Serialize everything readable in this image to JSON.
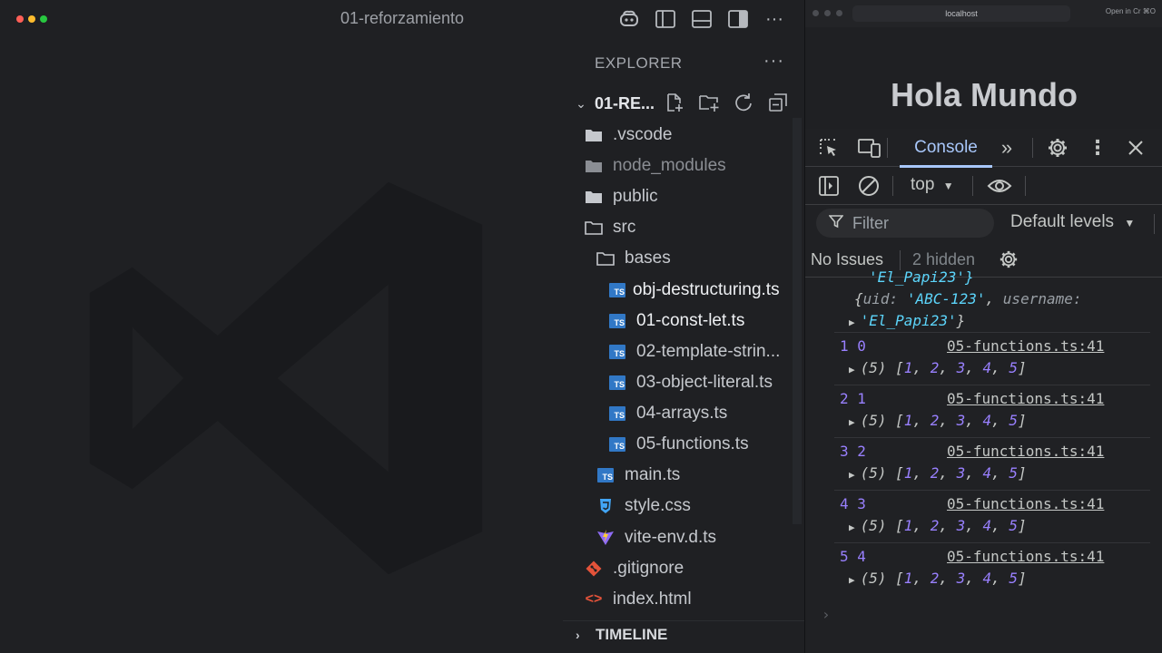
{
  "vscode": {
    "window_title": "01-reforzamiento",
    "explorer": {
      "header": "EXPLORER",
      "more": "···",
      "project": "01-RE...",
      "timeline": "TIMELINE",
      "tree": [
        {
          "label": ".vscode",
          "type": "folder"
        },
        {
          "label": "node_modules",
          "type": "folder"
        },
        {
          "label": "public",
          "type": "folder"
        },
        {
          "label": "src",
          "type": "folder-open"
        },
        {
          "label": "bases",
          "type": "folder"
        },
        {
          "label": "obj-destructuring.ts",
          "type": "ts"
        },
        {
          "label": "01-const-let.ts",
          "type": "ts"
        },
        {
          "label": "02-template-strin...",
          "type": "ts"
        },
        {
          "label": "03-object-literal.ts",
          "type": "ts"
        },
        {
          "label": "04-arrays.ts",
          "type": "ts"
        },
        {
          "label": "05-functions.ts",
          "type": "ts"
        },
        {
          "label": "main.ts",
          "type": "ts"
        },
        {
          "label": "style.css",
          "type": "css"
        },
        {
          "label": "vite-env.d.ts",
          "type": "vite"
        },
        {
          "label": ".gitignore",
          "type": "git"
        },
        {
          "label": "index.html",
          "type": "html"
        }
      ]
    }
  },
  "browser": {
    "address": "localhost",
    "open_in": "Open in Cr  ⌘O",
    "page_heading": "Hola Mundo",
    "devtools": {
      "tab_console": "Console",
      "context": "top",
      "filter_placeholder": "Filter",
      "levels": "Default levels",
      "no_issues": "No Issues",
      "hidden": "2 hidden",
      "ts_badge": "TS",
      "partial_top": "'El_Papi23'}",
      "object_line": {
        "uid_key": "uid:",
        "uid_val": "'ABC-123'",
        "username_key": "username:",
        "username_val": "'El_Papi23'"
      },
      "logs": [
        {
          "text": "1 0",
          "source": "05-functions.ts:41",
          "array_len": "(5)",
          "array": [
            "1",
            "2",
            "3",
            "4",
            "5"
          ]
        },
        {
          "text": "2 1",
          "source": "05-functions.ts:41",
          "array_len": "(5)",
          "array": [
            "1",
            "2",
            "3",
            "4",
            "5"
          ]
        },
        {
          "text": "3 2",
          "source": "05-functions.ts:41",
          "array_len": "(5)",
          "array": [
            "1",
            "2",
            "3",
            "4",
            "5"
          ]
        },
        {
          "text": "4 3",
          "source": "05-functions.ts:41",
          "array_len": "(5)",
          "array": [
            "1",
            "2",
            "3",
            "4",
            "5"
          ]
        },
        {
          "text": "5 4",
          "source": "05-functions.ts:41",
          "array_len": "(5)",
          "array": [
            "1",
            "2",
            "3",
            "4",
            "5"
          ]
        }
      ]
    }
  }
}
